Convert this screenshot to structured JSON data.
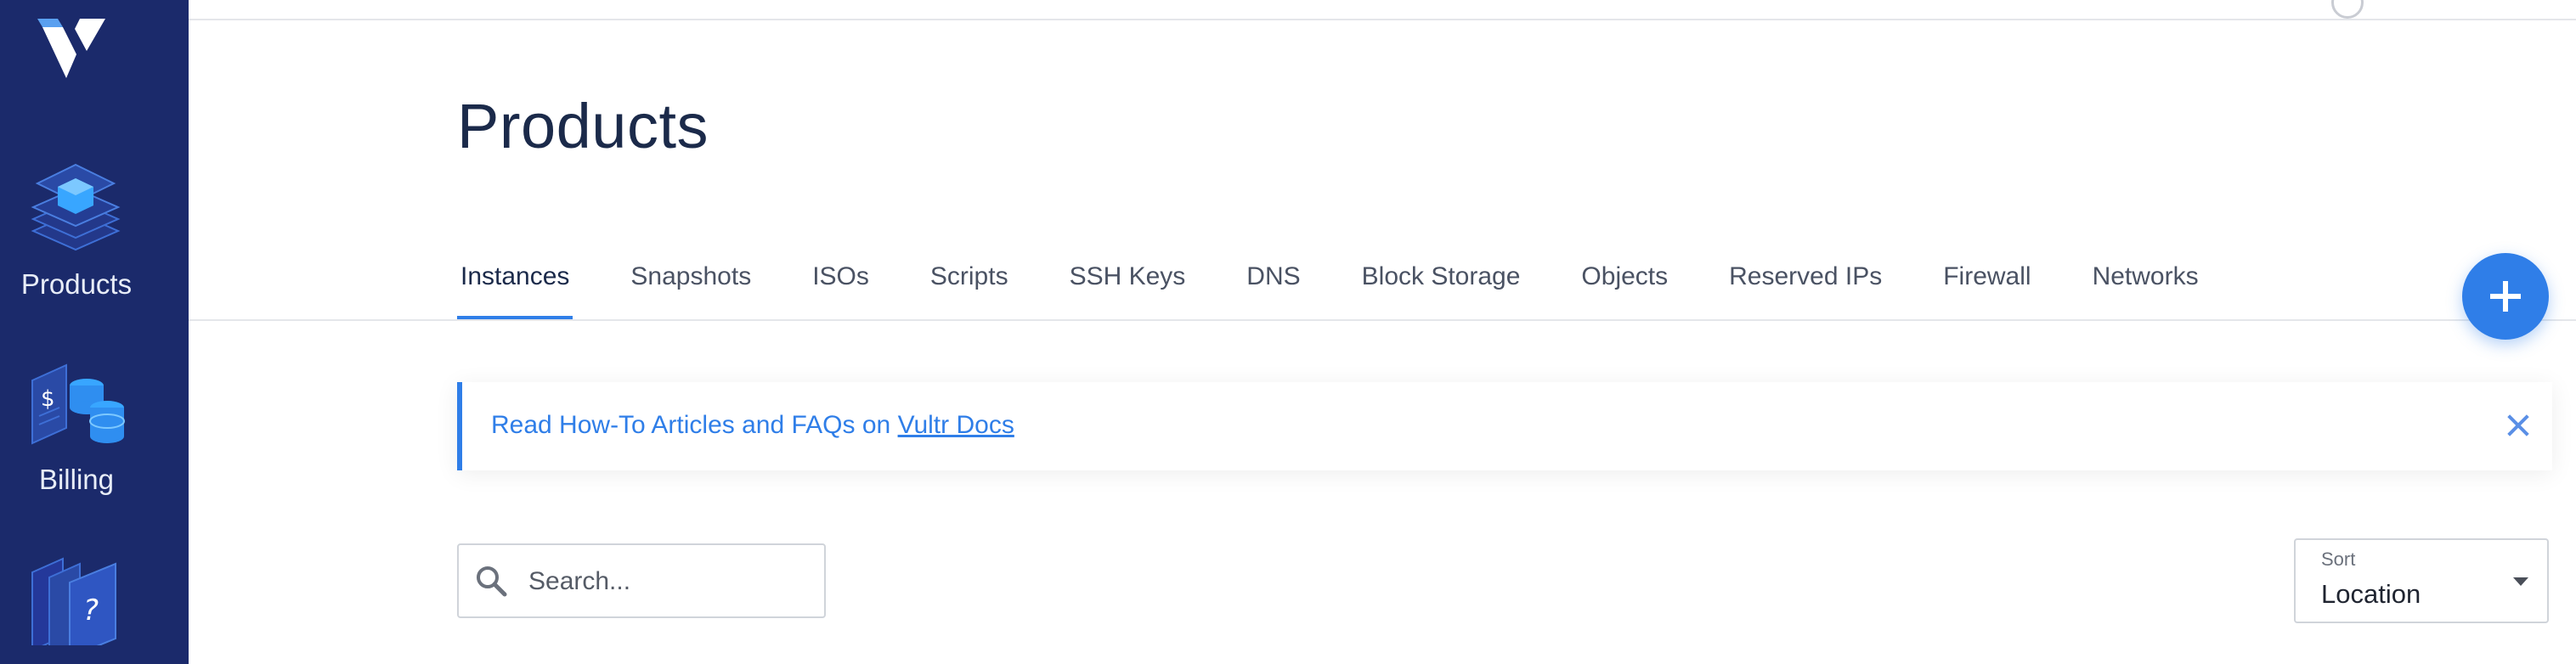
{
  "colors": {
    "sidebar": "#1b2a6b",
    "accent": "#2f7ee8",
    "title": "#1b2a4a"
  },
  "sidebar": {
    "logo_icon": "vultr-logo-icon",
    "items": [
      {
        "label": "Products",
        "icon": "products-layers-icon"
      },
      {
        "label": "Billing",
        "icon": "billing-coins-icon"
      },
      {
        "label": "",
        "icon": "help-docs-icon"
      }
    ]
  },
  "main": {
    "title": "Products",
    "tabs": [
      {
        "label": "Instances",
        "active": true
      },
      {
        "label": "Snapshots"
      },
      {
        "label": "ISOs"
      },
      {
        "label": "Scripts"
      },
      {
        "label": "SSH Keys"
      },
      {
        "label": "DNS"
      },
      {
        "label": "Block Storage"
      },
      {
        "label": "Objects"
      },
      {
        "label": "Reserved IPs"
      },
      {
        "label": "Firewall"
      },
      {
        "label": "Networks"
      }
    ],
    "add_button_icon": "plus-icon"
  },
  "banner": {
    "text": "Read How-To Articles and FAQs on ",
    "link_text": "Vultr Docs",
    "close_icon": "close-icon"
  },
  "search": {
    "placeholder": "Search..."
  },
  "sort": {
    "label": "Sort",
    "value": "Location"
  }
}
